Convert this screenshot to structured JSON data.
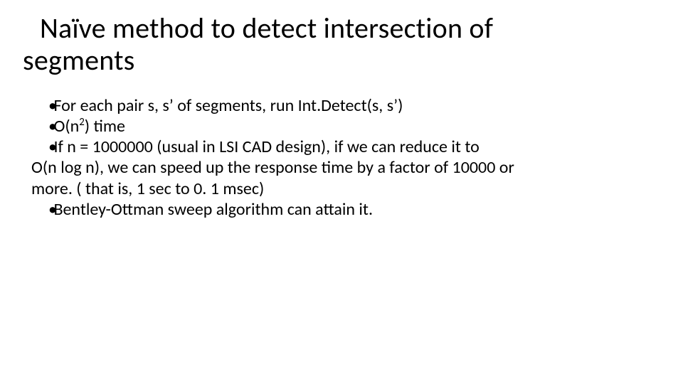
{
  "title_line1": "Naïve method to detect intersection of",
  "title_line2": "segments",
  "bullets": {
    "b1": "For each pair s, s’ of segments,  run Int.Detect(s, s’)",
    "b2_pre": "O(n",
    "b2_sup": "2",
    "b2_post": ") time",
    "b3": "If n = 1000000 (usual in LSI CAD design),  if we can reduce it to",
    "b3_cont1": "O(n log n), we can speed up the response time by a factor of 10000 or",
    "b3_cont2": "more. ( that is, 1 sec to 0. 1 msec)",
    "b4": "Bentley-Ottman sweep algorithm can attain it."
  },
  "marks": {
    "dot": "•"
  }
}
